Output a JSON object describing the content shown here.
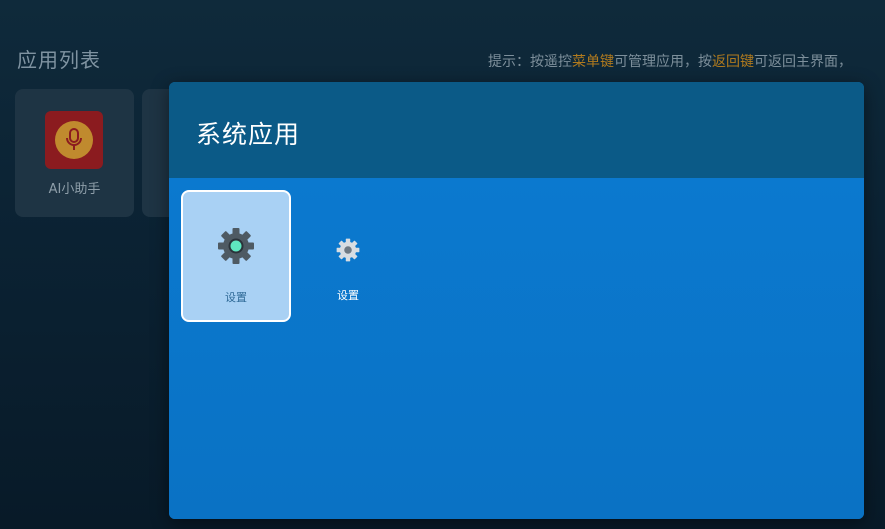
{
  "page": {
    "title": "应用列表",
    "hint_segments": [
      {
        "text": "提示：按遥控",
        "highlight": false
      },
      {
        "text": "菜单键",
        "highlight": true
      },
      {
        "text": "可管理应用，按",
        "highlight": false
      },
      {
        "text": "返回键",
        "highlight": true
      },
      {
        "text": "可返回主界面，",
        "highlight": false
      }
    ]
  },
  "background_apps": [
    {
      "label": "AI小助手",
      "icon": "microphone-icon"
    }
  ],
  "dialog": {
    "title": "系统应用",
    "apps": [
      {
        "label": "设置",
        "icon": "gear-icon",
        "selected": true
      },
      {
        "label": "设置",
        "icon": "gear-icon",
        "selected": false
      }
    ]
  },
  "colors": {
    "accent_highlight": "#b07a1e",
    "dialog_body": "#0a73c6",
    "dialog_header": "#0b5a87",
    "selected_tile": "#a9d1f4"
  }
}
